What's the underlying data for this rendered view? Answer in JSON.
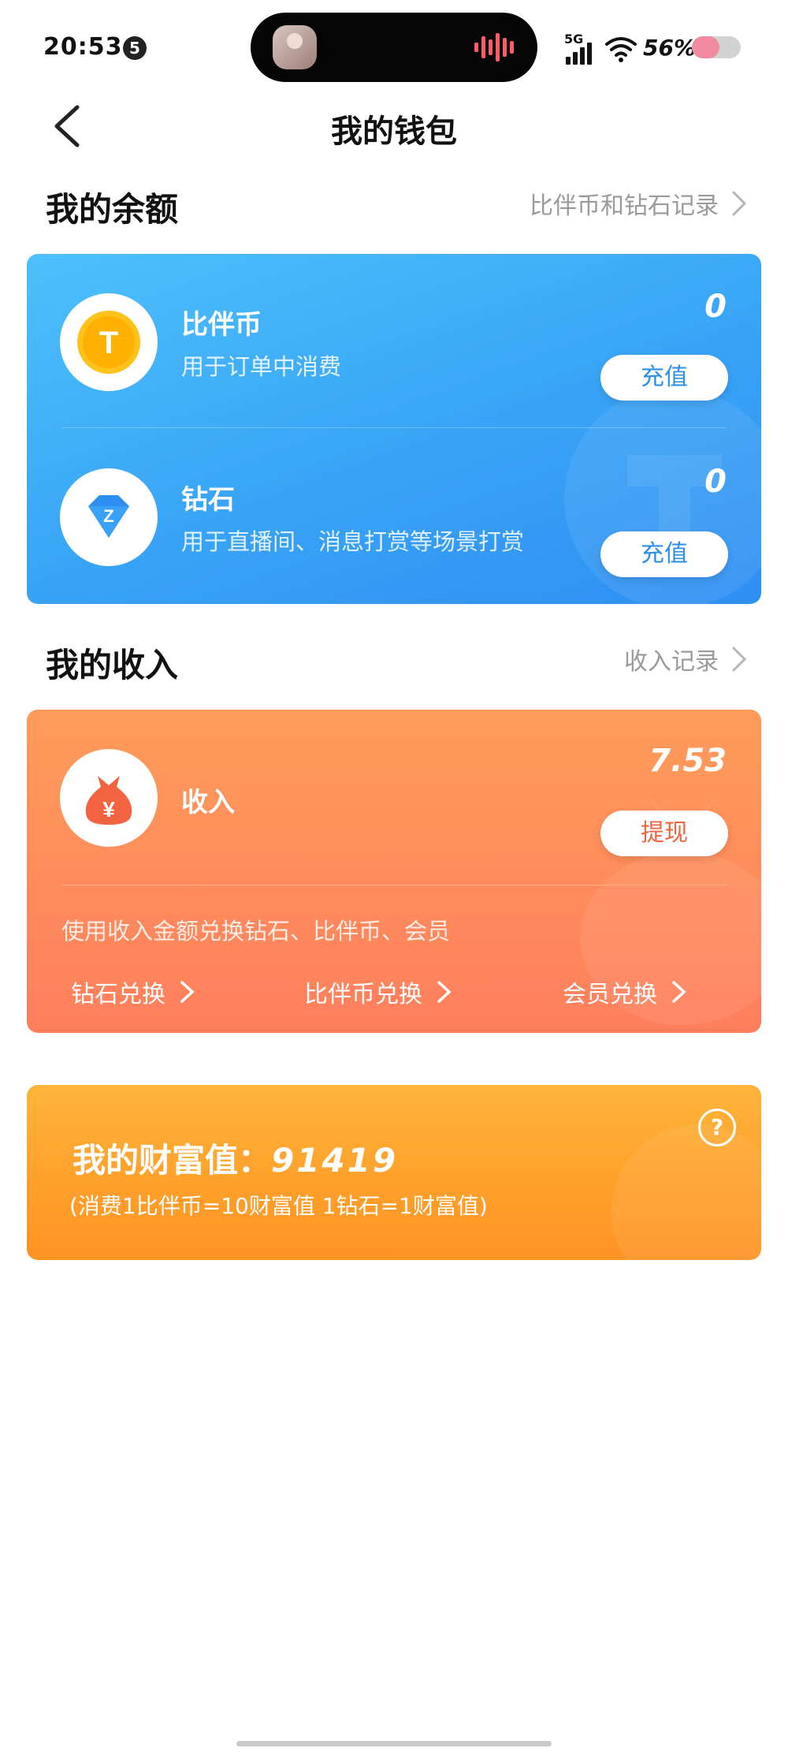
{
  "status_bar": {
    "time": "20:53",
    "notification_count": "5",
    "network": "5G",
    "battery_percent": "56%",
    "battery_level": 0.56
  },
  "header": {
    "title": "我的钱包"
  },
  "balance": {
    "section_title": "我的余额",
    "record_link": "比伴币和钻石记录",
    "items": [
      {
        "title": "比伴币",
        "subtitle": "用于订单中消费",
        "value": "0",
        "button": "充值",
        "icon_letter": "T"
      },
      {
        "title": "钻石",
        "subtitle": "用于直播间、消息打赏等场景打赏",
        "value": "0",
        "button": "充值",
        "icon_letter": "Z"
      }
    ]
  },
  "income": {
    "section_title": "我的收入",
    "record_link": "收入记录",
    "title": "收入",
    "value": "7.53",
    "button": "提现",
    "icon_symbol": "¥",
    "hint": "使用收入金额兑换钻石、比伴币、会员",
    "exchanges": [
      "钻石兑换",
      "比伴币兑换",
      "会员兑换"
    ]
  },
  "wealth": {
    "label": "我的财富值：",
    "value": "91419",
    "note": "(消费1比伴币=10财富值 1钻石=1财富值)",
    "help_symbol": "?"
  },
  "colors": {
    "blue_card": "#3aa6f7",
    "orange_card": "#ff8a5c",
    "yellow_card": "#ff9f2a",
    "blue_button_text": "#2b8fe6",
    "orange_button_text": "#f4633f"
  }
}
